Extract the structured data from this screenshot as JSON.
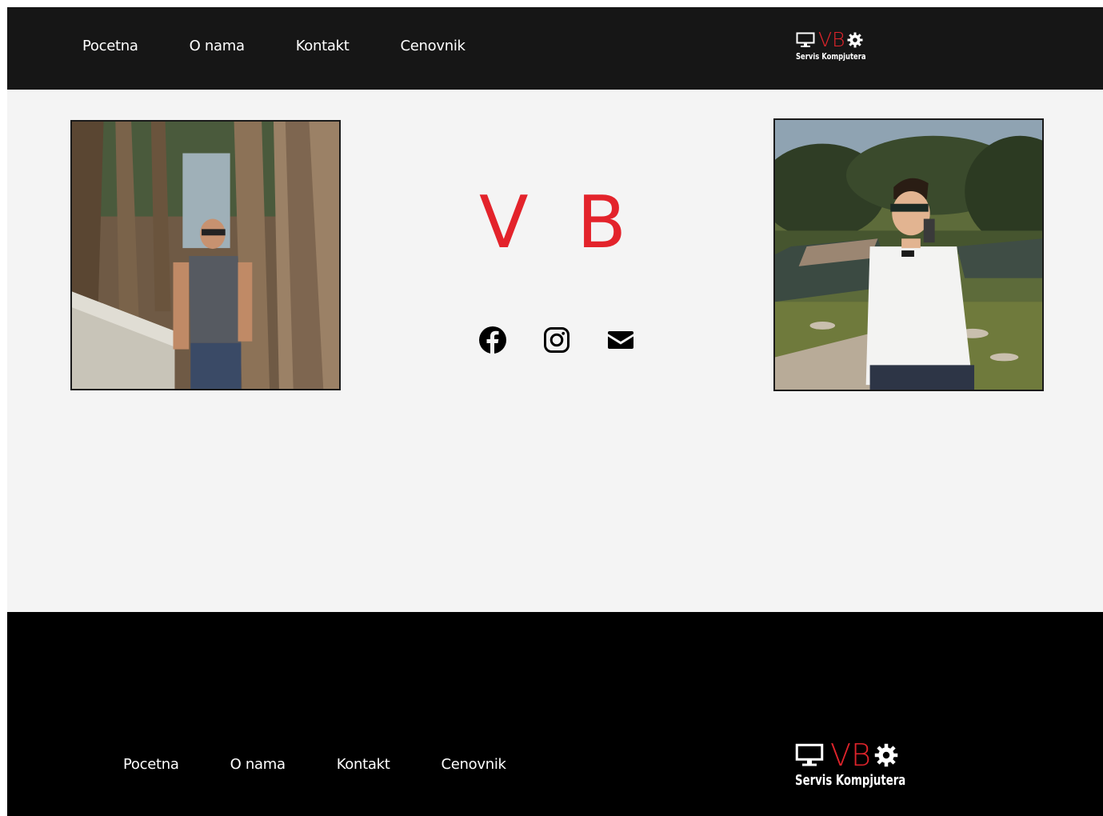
{
  "header": {
    "nav": [
      "Pocetna",
      "O nama",
      "Kontakt",
      "Cenovnik"
    ],
    "logo": {
      "title": "VB",
      "subtitle": "Servis Kompjutera"
    }
  },
  "hero": {
    "title": "V B",
    "socials": [
      {
        "icon": "facebook-icon"
      },
      {
        "icon": "instagram-icon"
      },
      {
        "icon": "envelope-icon"
      }
    ]
  },
  "footer": {
    "nav": [
      "Pocetna",
      "O nama",
      "Kontakt",
      "Cenovnik"
    ],
    "logo": {
      "title": "VB",
      "subtitle": "Servis Kompjutera"
    }
  },
  "colors": {
    "brand_red": "#e3232b",
    "header_bg": "#161616",
    "footer_bg": "#000000",
    "page_bg": "#f4f4f4"
  }
}
